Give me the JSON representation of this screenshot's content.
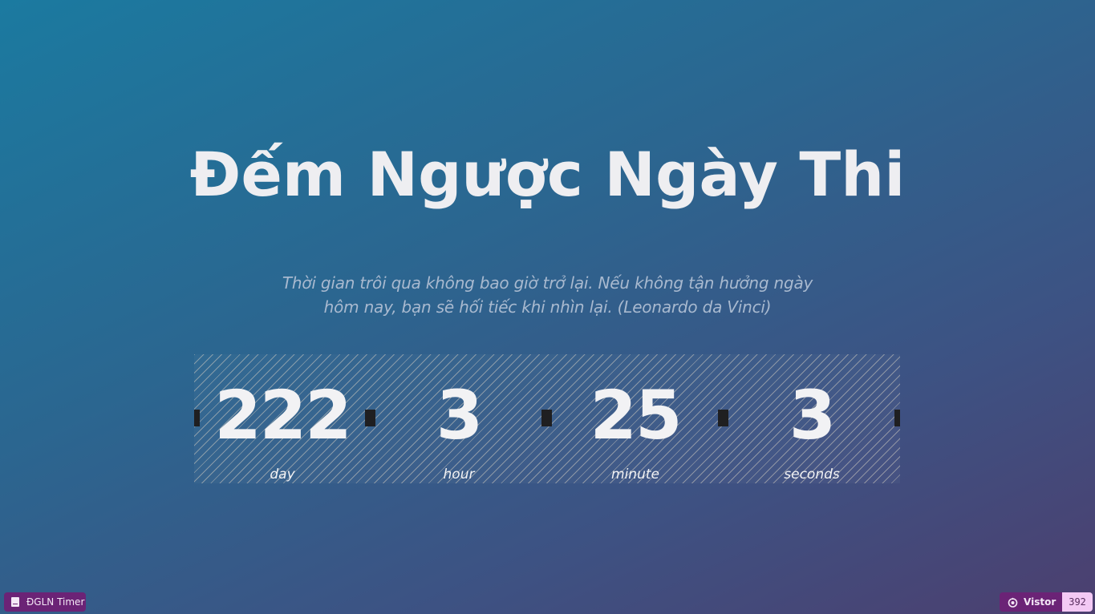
{
  "title": "Đếm Ngược Ngày Thi",
  "quote": "Thời gian trôi qua không bao giờ trở lại. Nếu không tận hưởng ngày hôm nay, bạn sẽ hối tiếc khi nhìn lại. (Leonardo da Vinci)",
  "countdown": {
    "days": "222",
    "hours": "3",
    "minutes": "25",
    "seconds": "3",
    "labels": {
      "days": "day",
      "hours": "hour",
      "minutes": "minute",
      "seconds": "seconds"
    }
  },
  "footer": {
    "app_badge": {
      "label": "ĐGLN Timer",
      "icon": "book-icon"
    },
    "visitor_badge": {
      "label": "Vistor",
      "count": "392",
      "icon": "eye-icon"
    }
  },
  "colors": {
    "badge_bg": "#6b2376",
    "badge_value_bg": "#f3c9f4",
    "separator": "#1f1f21"
  }
}
